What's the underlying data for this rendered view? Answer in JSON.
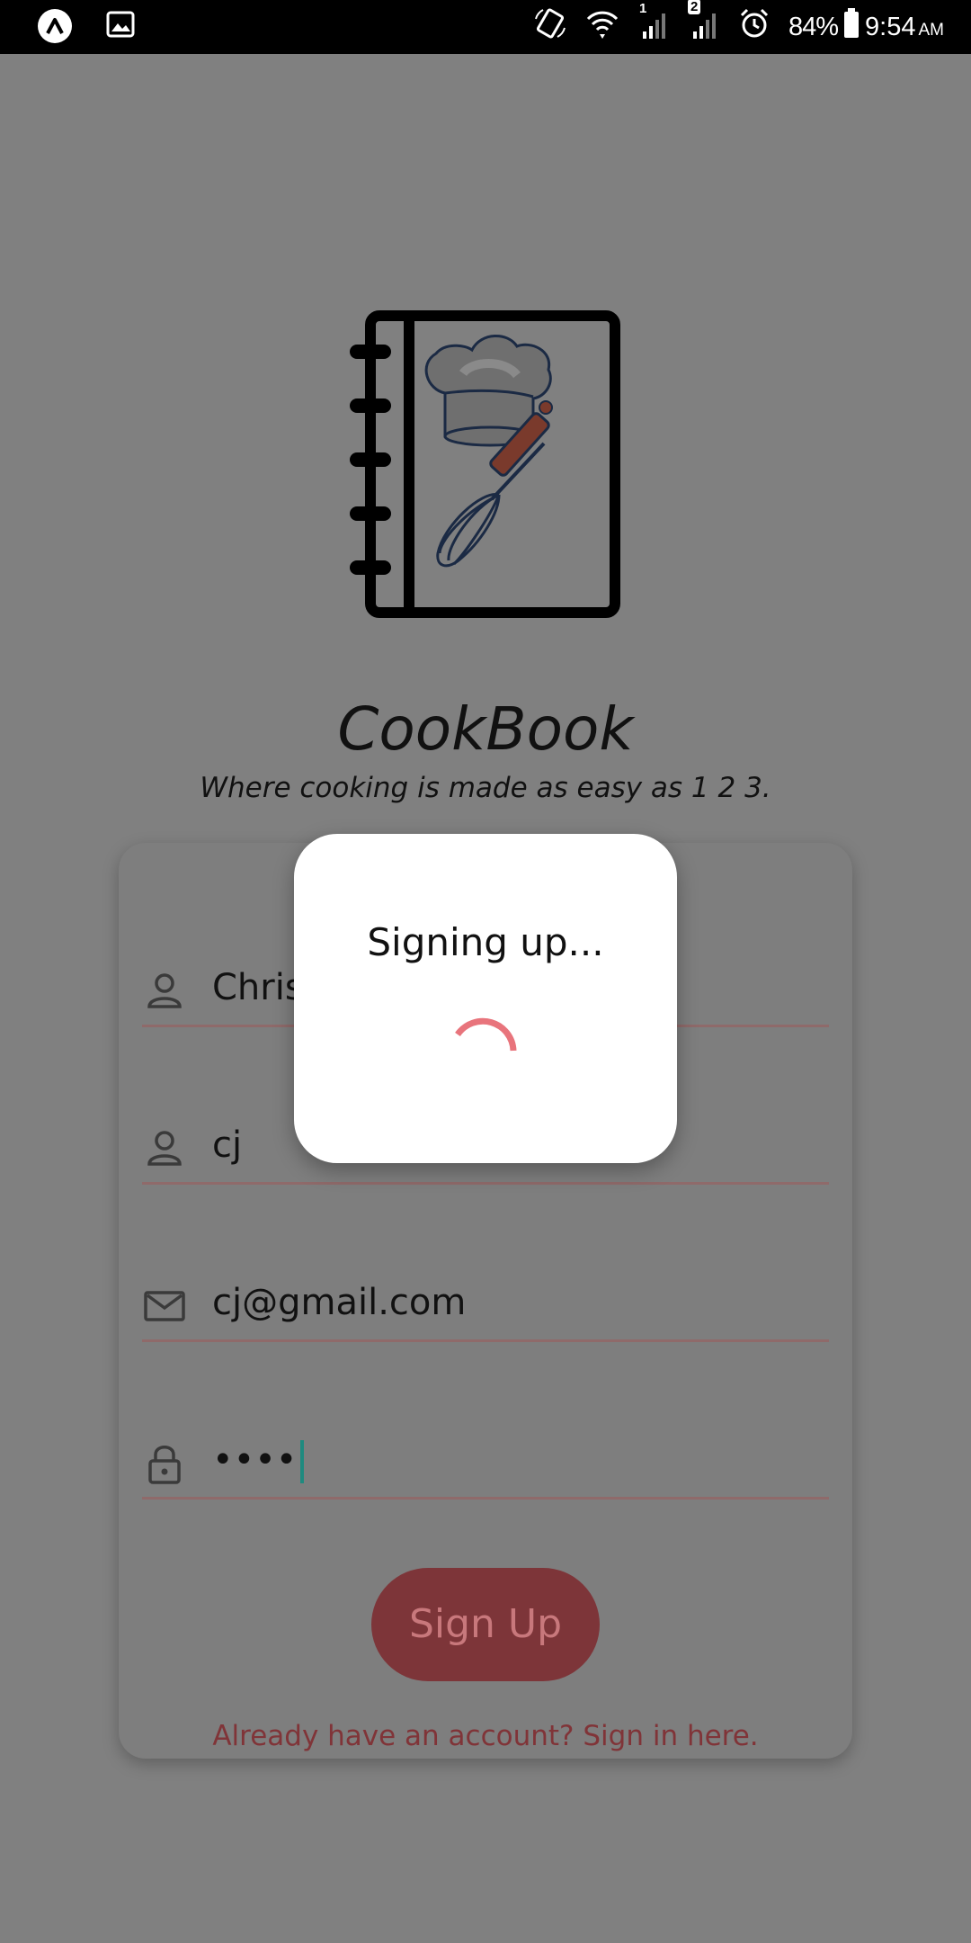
{
  "status_bar": {
    "battery_percent": "84%",
    "time": "9:54",
    "ampm": "AM",
    "sim1_label": "1",
    "sim2_label": "2"
  },
  "app": {
    "name": "CookBook",
    "tagline": "Where cooking is made as easy as 1 2 3."
  },
  "form": {
    "title": "Sign Up",
    "fields": [
      {
        "icon": "person-icon",
        "value": "Chris"
      },
      {
        "icon": "person-icon",
        "value": "cj"
      },
      {
        "icon": "mail-icon",
        "value": "cj@gmail.com"
      },
      {
        "icon": "lock-icon",
        "value": "••••"
      }
    ],
    "submit_label": "Sign Up",
    "signin_link": "Already have an account? Sign in here."
  },
  "dialog": {
    "message": "Signing up...",
    "spinner_color": "#e8747c"
  },
  "colors": {
    "scrim": "#808080",
    "accent": "#e8747c",
    "button_dimmed": "#7d3539",
    "link_dimmed": "#803438",
    "caret": "#1f8a7f"
  }
}
